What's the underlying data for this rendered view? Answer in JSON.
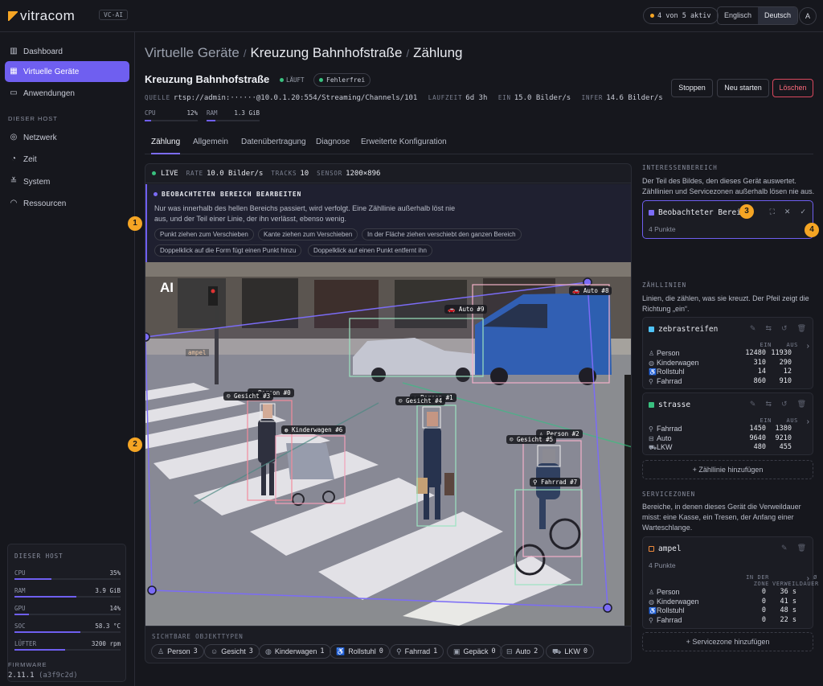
{
  "app": {
    "logo": "vitracom",
    "tag": "VC-AI",
    "status": "4 von 5 aktiv",
    "langs": [
      "Englisch",
      "Deutsch"
    ],
    "avatar": "A"
  },
  "nav": {
    "main": [
      "Dashboard",
      "Virtuelle Geräte",
      "Anwendungen"
    ],
    "section": "DIESER HOST",
    "host": [
      "Netzwerk",
      "Zeit",
      "System",
      "Ressourcen"
    ]
  },
  "hoststats": {
    "title": "DIESER HOST",
    "rows": [
      {
        "label": "CPU",
        "value": "35%",
        "level": 0.35
      },
      {
        "label": "RAM",
        "value": "3.9 GiB",
        "level": 0.58
      },
      {
        "label": "GPU",
        "value": "14%",
        "level": 0.14
      },
      {
        "label": "SOC",
        "value": "58.3 °C",
        "level": 0.62
      },
      {
        "label": "LÜFTER",
        "value": "3200 rpm",
        "level": 0.48
      }
    ]
  },
  "firmware": {
    "label": "FIRMWARE",
    "version": "2.11.1",
    "hash": "(a3f9c2d)"
  },
  "breadcrumb": {
    "root": "Virtuelle Geräte",
    "sep": "/",
    "device": "Kreuzung Bahnhofstraße",
    "page": "Zählung"
  },
  "device": {
    "title": "Kreuzung Bahnhofstraße",
    "state": "LÄUFT",
    "health": "Fehlerfrei",
    "meta": {
      "source_k": "QUELLE",
      "source": "rtsp://admin:······@10.0.1.20:554/Streaming/Channels/101",
      "runtime_k": "LAUFZEIT",
      "runtime": "6d 3h",
      "in_k": "EIN",
      "in": "15.0 Bilder/s",
      "infer_k": "INFER",
      "infer": "14.6 Bilder/s"
    },
    "cpu": {
      "label": "CPU",
      "value": "12%",
      "level": 0.12
    },
    "ram": {
      "label": "RAM",
      "value": "1.3 GiB",
      "level": 0.17
    },
    "buttons": {
      "stop": "Stoppen",
      "restart": "Neu starten",
      "delete": "Löschen"
    }
  },
  "tabs": [
    "Zählung",
    "Allgemein",
    "Datenübertragung",
    "Diagnose",
    "Erweiterte Konfiguration"
  ],
  "live": {
    "label": "LIVE",
    "rate_k": "RATE",
    "rate": "10.0 Bilder/s",
    "tracks_k": "TRACKS",
    "tracks": "10",
    "sensor_k": "SENSOR",
    "sensor": "1200×896"
  },
  "edit": {
    "title": "BEOBACHTETEN BEREICH BEARBEITEN",
    "desc": "Nur was innerhalb des hellen Bereichs passiert, wird verfolgt. Eine Zähllinie außerhalb löst nie aus, und der Teil einer Linie, der ihn verlässt, ebenso wenig.",
    "hints": [
      "Punkt ziehen zum Verschieben",
      "Kante ziehen zum Verschieben",
      "In der Fläche ziehen verschiebt den ganzen Bereich",
      "Doppelklick auf die Form fügt einen Punkt hinzu",
      "Doppelklick auf einen Punkt entfernt ihn"
    ]
  },
  "scene": {
    "watermark": "AI",
    "zone_tag": "ampel",
    "labels": [
      "Auto #8",
      "Auto #9",
      "Person #0",
      "Gesicht #3",
      "Kinderwagen #6",
      "Person #1",
      "Gesicht #4",
      "Person #2",
      "Gesicht #5",
      "Fahrrad #7"
    ]
  },
  "visible": {
    "title": "SICHTBARE OBJEKTTYPEN",
    "items": [
      {
        "label": "Person",
        "count": "3",
        "icon": "person"
      },
      {
        "label": "Gesicht",
        "count": "3",
        "icon": "face"
      },
      {
        "label": "Kinderwagen",
        "count": "1",
        "icon": "stroller"
      },
      {
        "label": "Rollstuhl",
        "count": "0",
        "icon": "wheelchair"
      },
      {
        "label": "Fahrrad",
        "count": "1",
        "icon": "bicycle"
      },
      {
        "label": "Gepäck",
        "count": "0",
        "icon": "luggage"
      },
      {
        "label": "Auto",
        "count": "2",
        "icon": "car"
      },
      {
        "label": "LKW",
        "count": "0",
        "icon": "truck"
      }
    ]
  },
  "interest": {
    "title": "INTERESSENBEREICH",
    "desc": "Der Teil des Bildes, den dieses Gerät auswertet. Zähllinien und Servicezonen außerhalb lösen nie aus.",
    "card_title": "Beobachteter Bereich",
    "points": "4 Punkte"
  },
  "lines": {
    "title": "ZÄHLLINIEN",
    "desc": "Linien, die zählen, was sie kreuzt. Der Pfeil zeigt die Richtung „ein“.",
    "col_in": "EIN",
    "col_out": "AUS",
    "items": [
      {
        "name": "zebrastreifen",
        "color": "#4fc3f7",
        "rows": [
          [
            "Person",
            "12480",
            "11930"
          ],
          [
            "Kinderwagen",
            "310",
            "290"
          ],
          [
            "Rollstuhl",
            "14",
            "12"
          ],
          [
            "Fahrrad",
            "860",
            "910"
          ]
        ]
      },
      {
        "name": "strasse",
        "color": "#39c07f",
        "rows": [
          [
            "Fahrrad",
            "1450",
            "1380"
          ],
          [
            "Auto",
            "9640",
            "9210"
          ],
          [
            "LKW",
            "480",
            "455"
          ]
        ]
      }
    ],
    "add": "Zähllinie hinzufügen"
  },
  "zones": {
    "title": "SERVICEZONEN",
    "desc": "Bereiche, in denen dieses Gerät die Verweildauer misst: eine Kasse, ein Tresen, der Anfang einer Warteschlange.",
    "item": {
      "name": "ampel",
      "color": "#f08a3c",
      "points": "4 Punkte",
      "col_a": "IN DER ZONE",
      "col_b": "Ø VERWEILDAUER",
      "rows": [
        [
          "Person",
          "0",
          "36 s"
        ],
        [
          "Kinderwagen",
          "0",
          "41 s"
        ],
        [
          "Rollstuhl",
          "0",
          "48 s"
        ],
        [
          "Fahrrad",
          "0",
          "22 s"
        ]
      ]
    },
    "add": "Servicezone hinzufügen"
  },
  "markers": [
    "1",
    "2",
    "3",
    "4"
  ],
  "colors": {
    "accent": "#6f5ff0",
    "ok": "#39c07f",
    "warn": "#f5a524",
    "danger": "#d9485e"
  }
}
